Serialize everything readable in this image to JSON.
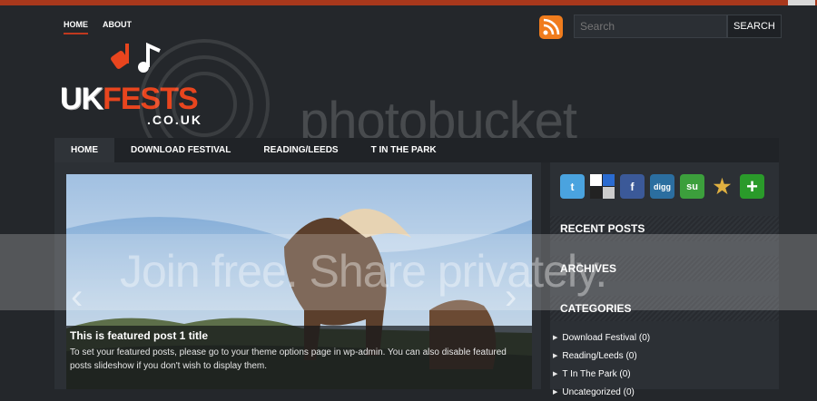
{
  "top_nav": {
    "items": [
      {
        "label": "HOME",
        "active": true
      },
      {
        "label": "ABOUT",
        "active": false
      }
    ]
  },
  "search": {
    "placeholder": "Search",
    "button_label": "SEARCH"
  },
  "logo": {
    "word_uk": "UK",
    "word_fests": "FESTS",
    "sub": ".CO.UK"
  },
  "main_nav": {
    "items": [
      {
        "label": "HOME",
        "active": true
      },
      {
        "label": "DOWNLOAD FESTIVAL",
        "active": false
      },
      {
        "label": "READING/LEEDS",
        "active": false
      },
      {
        "label": "T IN THE PARK",
        "active": false
      }
    ]
  },
  "slideshow": {
    "title": "This is featured post 1 title",
    "text": "To set your featured posts, please go to your theme options page in wp-admin. You can also disable featured posts slideshow if you don't wish to display them.",
    "prev_icon": "chevron-left-icon",
    "next_icon": "chevron-right-icon"
  },
  "social": [
    {
      "name": "twitter-icon",
      "glyph": "t",
      "color": "#4aa3df"
    },
    {
      "name": "delicious-icon",
      "glyph": "",
      "color": "#ffffff"
    },
    {
      "name": "facebook-icon",
      "glyph": "f",
      "color": "#3b5998"
    },
    {
      "name": "digg-icon",
      "glyph": "digg",
      "color": "#2b6ea0"
    },
    {
      "name": "stumbleupon-icon",
      "glyph": "su",
      "color": "#3c9f3c"
    },
    {
      "name": "favorite-star-icon",
      "glyph": "★",
      "color": ""
    },
    {
      "name": "add-plus-icon",
      "glyph": "+",
      "color": "#2a9a2a"
    }
  ],
  "sidebar": {
    "recent_posts": "RECENT POSTS",
    "archives": "ARCHIVES",
    "categories": "CATEGORIES",
    "category_items": [
      "Download Festival (0)",
      "Reading/Leeds (0)",
      "T In The Park (0)",
      "Uncategorized (0)"
    ]
  },
  "watermark": {
    "band_text": "Join free. Share privately.",
    "brand_text": "photobucket"
  },
  "colors": {
    "accent": "#e8451e",
    "background": "#24272b",
    "topbar": "#a8381c"
  }
}
